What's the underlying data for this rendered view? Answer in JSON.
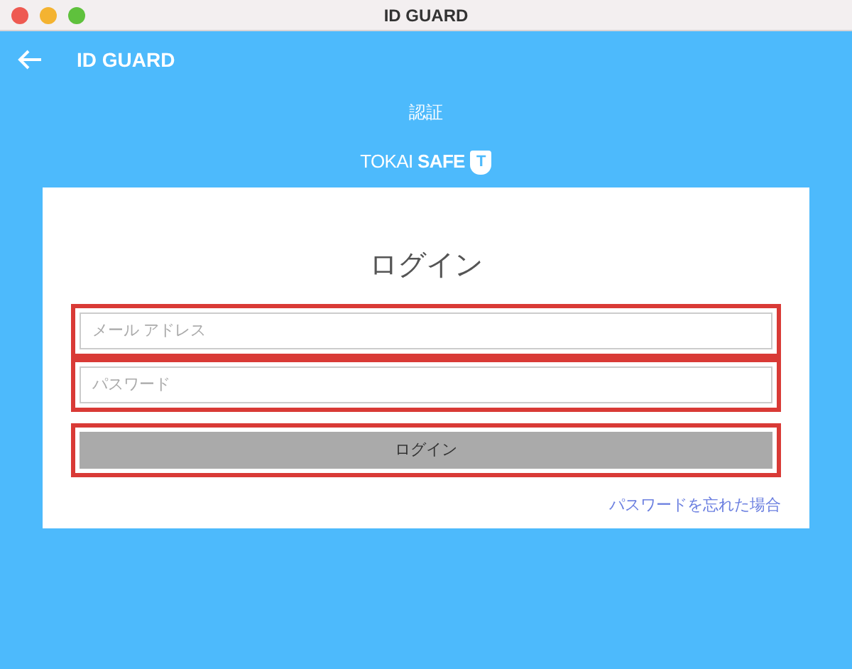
{
  "window": {
    "title": "ID GUARD"
  },
  "header": {
    "title": "ID GUARD"
  },
  "section_title": "認証",
  "logo": {
    "word_1": "TOKAI",
    "word_2": "SAFE",
    "shield_letter": "T"
  },
  "login": {
    "heading": "ログイン",
    "fields": [
      {
        "placeholder": "メール アドレス",
        "highlighted": true
      },
      {
        "placeholder": "パスワード",
        "highlighted": true
      }
    ],
    "button": {
      "label": "ログイン",
      "highlighted": true
    },
    "forgot_link": "パスワードを忘れた場合"
  }
}
